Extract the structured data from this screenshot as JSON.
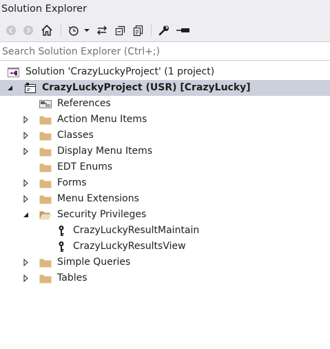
{
  "panel": {
    "title": "Solution Explorer"
  },
  "toolbar": {
    "buttons": [
      "back-icon",
      "forward-icon",
      "home-icon",
      "history-icon",
      "dropdown-icon",
      "sync-icon",
      "collapse-all-icon",
      "show-all-files-icon",
      "properties-wrench-icon",
      "preview-pin-icon"
    ]
  },
  "search": {
    "placeholder": "Search Solution Explorer (Ctrl+;)",
    "value": ""
  },
  "tree": {
    "solution": {
      "label": "Solution 'CrazyLuckyProject' (1 project)"
    },
    "project": {
      "label": "CrazyLuckyProject (USR) [CrazyLucky]",
      "expanded": true,
      "selected": true
    },
    "nodes": [
      {
        "label": "References",
        "icon": "references-icon",
        "expandable": false
      },
      {
        "label": "Action Menu Items",
        "icon": "folder-icon",
        "expandable": true,
        "expanded": false
      },
      {
        "label": "Classes",
        "icon": "folder-icon",
        "expandable": true,
        "expanded": false
      },
      {
        "label": "Display Menu Items",
        "icon": "folder-icon",
        "expandable": true,
        "expanded": false
      },
      {
        "label": "EDT Enums",
        "icon": "folder-icon",
        "expandable": false
      },
      {
        "label": "Forms",
        "icon": "folder-icon",
        "expandable": true,
        "expanded": false
      },
      {
        "label": "Menu Extensions",
        "icon": "folder-icon",
        "expandable": true,
        "expanded": false
      },
      {
        "label": "Security Privileges",
        "icon": "folder-open-icon",
        "expandable": true,
        "expanded": true,
        "children": [
          {
            "label": "CrazyLuckyResultMaintain",
            "icon": "key-icon"
          },
          {
            "label": "CrazyLuckyResultsView",
            "icon": "key-icon"
          }
        ]
      },
      {
        "label": "Simple Queries",
        "icon": "folder-icon",
        "expandable": true,
        "expanded": false
      },
      {
        "label": "Tables",
        "icon": "folder-icon",
        "expandable": true,
        "expanded": false
      }
    ]
  },
  "colors": {
    "chrome": "#eeeef2",
    "selection": "#ccd0dc",
    "folder": "#dcb67a",
    "solution_accent": "#68217a"
  }
}
